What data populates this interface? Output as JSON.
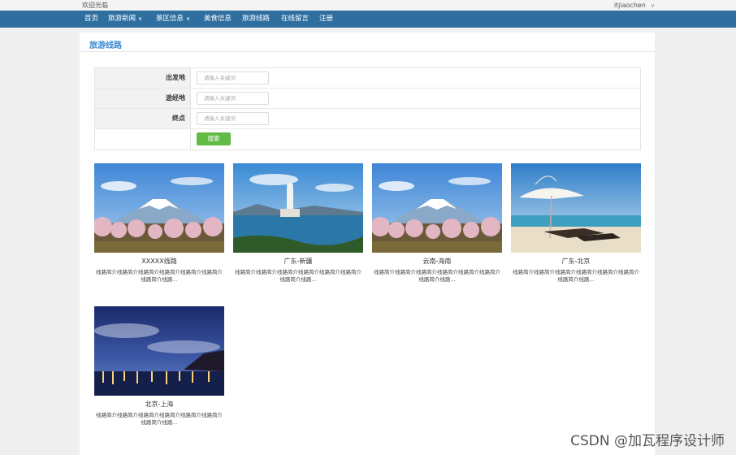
{
  "top": {
    "welcome": "欢迎光临",
    "username": "itjiaochen"
  },
  "nav": {
    "items": [
      {
        "label": "首页"
      },
      {
        "label": "旅游新闻"
      },
      {
        "label": "景区信息"
      },
      {
        "label": "美食信息"
      },
      {
        "label": "旅游线路"
      },
      {
        "label": "在线留言"
      },
      {
        "label": "注册"
      }
    ]
  },
  "panel": {
    "title": "旅游线路"
  },
  "search": {
    "fields": [
      {
        "label": "出发地",
        "placeholder": "请输入关键词"
      },
      {
        "label": "途经地",
        "placeholder": "请输入关键词"
      },
      {
        "label": "终点",
        "placeholder": "请输入关键词"
      }
    ],
    "button": "搜索"
  },
  "routes": [
    {
      "name": "XXXXX线路",
      "desc": "线路简介线路简介线路简介线路简介线路简介线路简介线路简介线路...",
      "image": "mountain-icon"
    },
    {
      "name": "广东-新疆",
      "desc": "线路简介线路简介线路简介线路简介线路简介线路简介线路简介线路...",
      "image": "statue-icon"
    },
    {
      "name": "云南-海南",
      "desc": "线路简介线路简介线路简介线路简介线路简介线路简介线路简介线路...",
      "image": "mountain-icon"
    },
    {
      "name": "广东-北京",
      "desc": "线路简介线路简介线路简介线路简介线路简介线路简介线路简介线路...",
      "image": "beach-icon"
    },
    {
      "name": "北京-上海",
      "desc": "线路简介线路简介线路简介线路简介线路简介线路简介线路简介线路...",
      "image": "night-city-icon"
    }
  ],
  "watermark": "CSDN @加瓦程序设计师"
}
